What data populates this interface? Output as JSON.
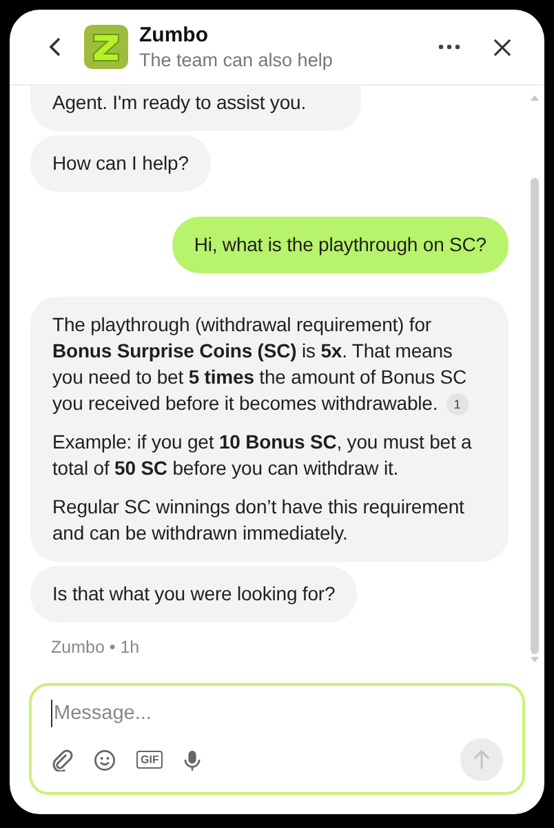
{
  "header": {
    "title": "Zumbo",
    "subtitle": "The team can also help"
  },
  "messages": [
    {
      "kind": "agent",
      "paragraphs": [
        {
          "text": "Agent. I'm ready to assist you."
        }
      ]
    },
    {
      "kind": "agent",
      "paragraphs": [
        {
          "text": "How can I help?"
        }
      ]
    },
    {
      "kind": "user",
      "paragraphs": [
        {
          "text": "Hi, what is the playthrough on SC?"
        }
      ]
    },
    {
      "kind": "agent",
      "paragraphs": [
        {
          "text": "The playthrough (withdrawal requirement) for **Bonus Surprise Coins (SC)** is **5x**. That means you need to bet **5 times** the amount of Bonus SC you received before it becomes withdrawable.",
          "citation": "1"
        },
        {
          "text": "Example: if you get **10 Bonus SC**, you must bet a total of **50 SC** before you can withdraw it."
        },
        {
          "text": "Regular SC winnings don’t have this requirement and can be withdrawn immediately."
        }
      ]
    },
    {
      "kind": "agent",
      "paragraphs": [
        {
          "text": "Is that what you were looking for?"
        }
      ]
    }
  ],
  "meta": "Zumbo • 1h",
  "composer": {
    "placeholder": "Message...",
    "gif_label": "GIF",
    "send_disabled": true
  }
}
